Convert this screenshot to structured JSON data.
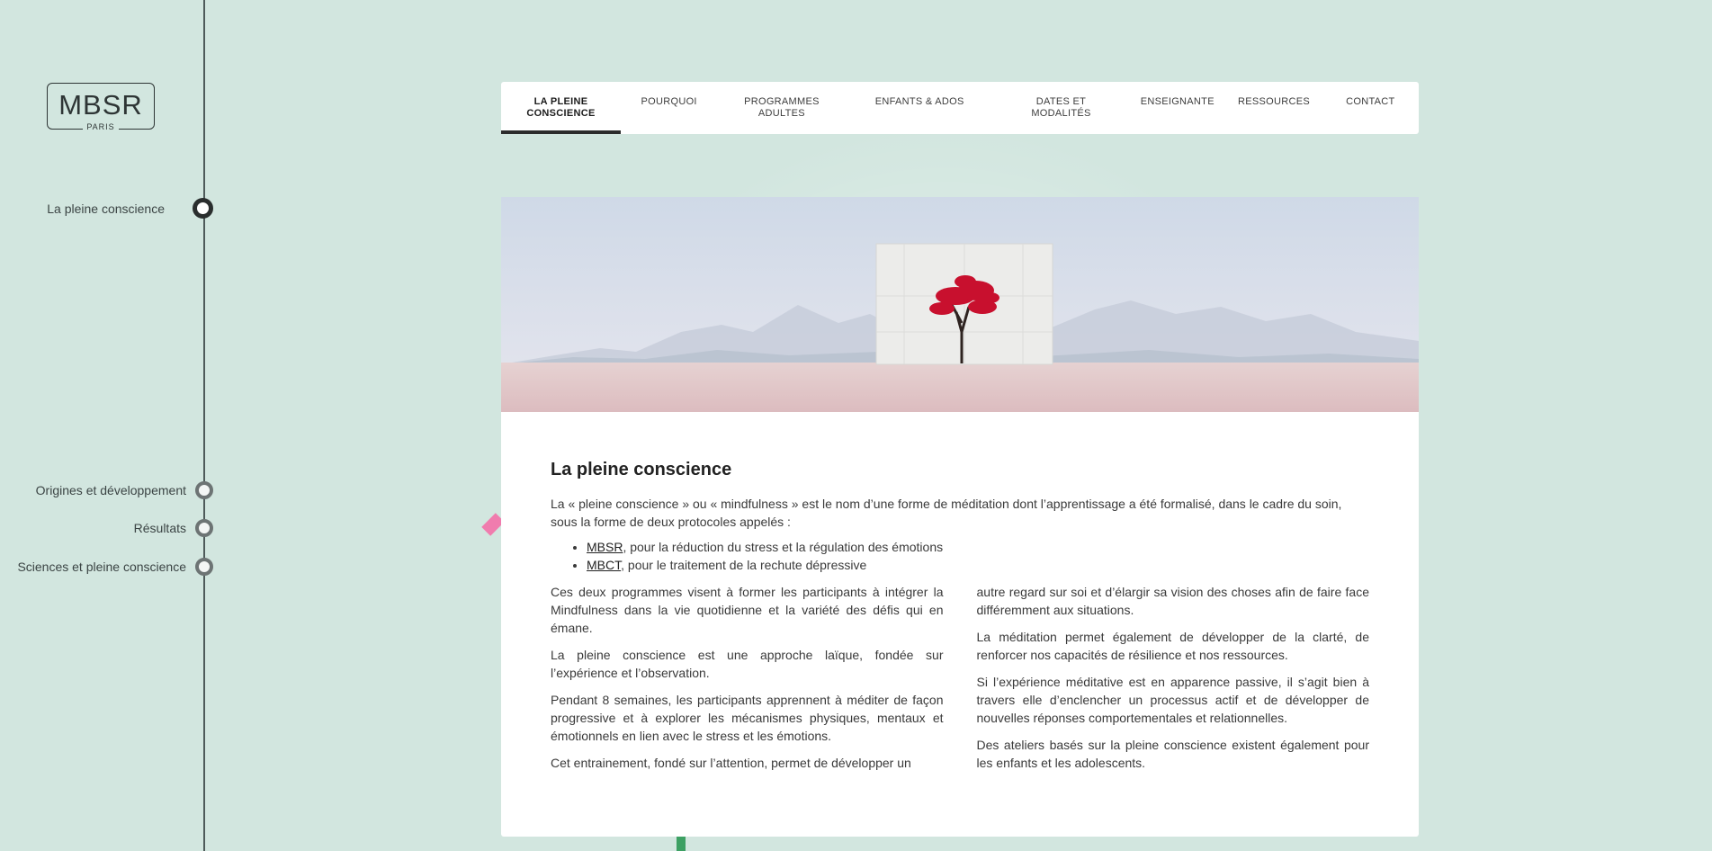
{
  "brand": {
    "logo_text": "MBSR",
    "logo_subtext": "PARIS"
  },
  "sidebar": {
    "items": [
      {
        "label": "La pleine conscience",
        "active": true
      },
      {
        "label": "Origines et développement",
        "active": false
      },
      {
        "label": "Résultats",
        "active": false
      },
      {
        "label": "Sciences et pleine conscience",
        "active": false
      }
    ]
  },
  "nav": {
    "items": [
      {
        "label": "La pleine conscience",
        "active": true
      },
      {
        "label": "Pourquoi",
        "active": false
      },
      {
        "label": "Programmes adultes",
        "active": false
      },
      {
        "label": "Enfants & ados",
        "active": false
      },
      {
        "label": "Dates et modalités",
        "active": false
      },
      {
        "label": "Enseignante",
        "active": false
      },
      {
        "label": "Ressources",
        "active": false
      },
      {
        "label": "Contact",
        "active": false
      }
    ]
  },
  "article": {
    "title": "La pleine conscience",
    "intro": "La « pleine conscience » ou « mindfulness » est le nom d’une forme de méditation dont l’apprentissage a été formalisé, dans le cadre du soin, sous la forme de deux protocoles appelés :",
    "list": [
      {
        "link": "MBSR",
        "text": ", pour la réduction du stress et la régulation des émotions"
      },
      {
        "link": "MBCT",
        "text": ", pour le traitement de la rechute dépressive"
      }
    ],
    "col_left": [
      "Ces deux programmes visent à former les participants à intégrer la Mindfulness dans la vie quotidienne et la variété des défis qui en émane.",
      "La pleine conscience est une approche laïque, fondée sur l’expérience et l’observation.",
      "Pendant 8 semaines, les participants apprennent à méditer de façon progressive et à explorer les mécanismes physiques, mentaux et émotionnels en lien avec le stress et les émotions.",
      "Cet entrainement, fondé sur l’attention, permet de développer un"
    ],
    "col_right": [
      "autre regard sur soi et d’élargir sa vision des choses afin de faire face différemment aux situations.",
      "La méditation permet également de développer de la clarté, de renforcer nos capacités de résilience et nos ressources.",
      "Si l’expérience méditative est en apparence passive, il s’agit bien à travers elle d’enclencher un processus actif et de développer de nouvelles réponses comportementales et relationnelles.",
      "Des ateliers basés sur la pleine conscience existent également pour les enfants et les adolescents."
    ]
  },
  "colors": {
    "background": "#d2e6df",
    "nav_active_underline": "#2c2c2c",
    "tree_leaves": "#c8102e"
  }
}
